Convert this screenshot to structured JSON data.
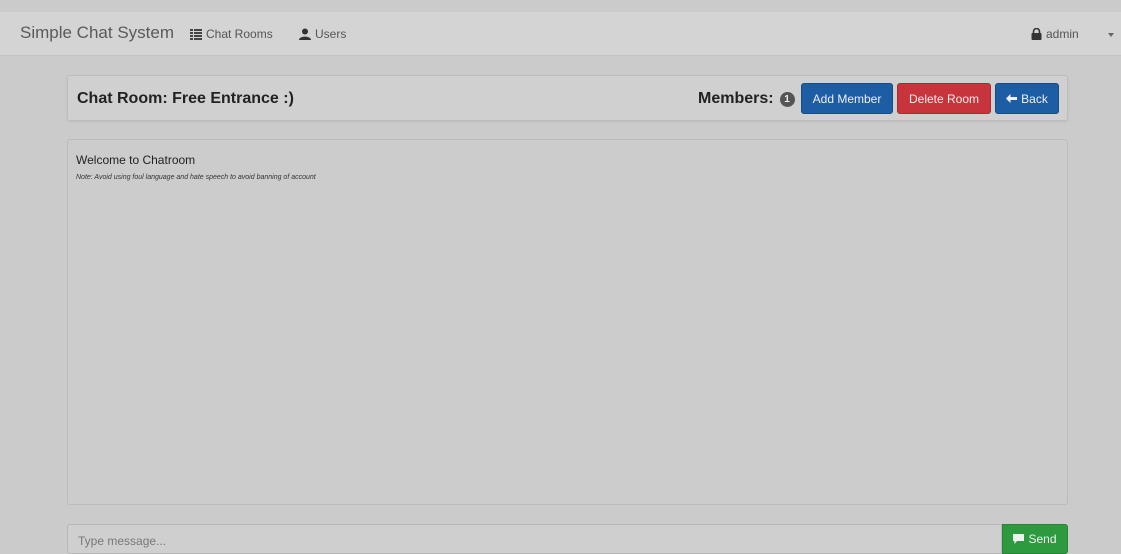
{
  "navbar": {
    "brand": "Simple Chat System",
    "links": [
      {
        "label": "Chat Rooms",
        "icon": "list-icon"
      },
      {
        "label": "Users",
        "icon": "user-icon"
      }
    ],
    "account": {
      "label": "admin",
      "icon": "lock-icon"
    }
  },
  "room": {
    "title": "Chat Room: Free Entrance :)",
    "members_label": "Members:",
    "members_count": "1",
    "buttons": {
      "add_member": "Add Member",
      "delete_room": "Delete Room",
      "back": "Back"
    },
    "colors": {
      "primary": "#1d5da4",
      "danger": "#c8343b",
      "success": "#2e9a3f"
    }
  },
  "chat": {
    "welcome": "Welcome to Chatroom",
    "note": "Note: Avoid using foul language and hate speech to avoid banning of account"
  },
  "composer": {
    "placeholder": "Type message...",
    "send_label": "Send"
  }
}
